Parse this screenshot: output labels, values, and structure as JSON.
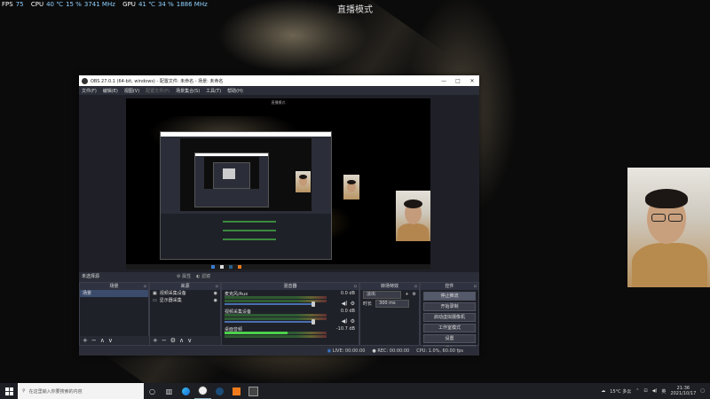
{
  "perf_overlay": [
    {
      "label": "FPS",
      "value": "75"
    },
    {
      "label": "CPU",
      "value": "40 ℃"
    },
    {
      "label": "",
      "value": "15 %"
    },
    {
      "label": "",
      "value": "3741 MHz"
    },
    {
      "label": "GPU",
      "value": "41 ℃"
    },
    {
      "label": "",
      "value": "34 %"
    },
    {
      "label": "",
      "value": "1886 MHz"
    }
  ],
  "live_banner": "直播模式",
  "obs": {
    "title": "OBS 27.0.1 (64-bit, windows) - 配置文件: 未命名 - 场景: 未命名",
    "window_controls": {
      "minimize": "—",
      "maximize": "□",
      "close": "✕"
    },
    "menu": [
      "文件(F)",
      "编辑(E)",
      "视图(V)",
      "配置文件(P)",
      "场景集合(S)",
      "工具(T)",
      "帮助(H)"
    ],
    "preview_label": "直播模式",
    "status_line": "未选择源",
    "scenes": {
      "header": "场景",
      "items": [
        "场景"
      ],
      "footer_icons": [
        "+",
        "−",
        "∧",
        "∨"
      ]
    },
    "sources": {
      "header": "来源",
      "items": [
        {
          "icon": "▣",
          "label": "视频采集设备"
        },
        {
          "icon": "▭",
          "label": "显示器采集"
        }
      ],
      "footer_icons": [
        "+",
        "−",
        "⚙",
        "∧",
        "∨"
      ],
      "props_label": "属性",
      "filters_label": "滤镜"
    },
    "mixer": {
      "header": "混音器",
      "channels": [
        {
          "name": "麦克风/Aux",
          "db": "0.0 dB",
          "level": 0.0
        },
        {
          "name": "视频采集设备",
          "db": "0.0 dB",
          "level": 0.0
        },
        {
          "name": "桌面音频",
          "db": "-10.7 dB",
          "level": 0.62
        }
      ]
    },
    "transitions": {
      "header": "转场特效",
      "type": "淡出",
      "duration_label": "时长",
      "duration": "300 ms"
    },
    "controls": {
      "header": "控件",
      "buttons": [
        "停止推流",
        "开始录制",
        "启动虚拟摄像机",
        "工作室模式",
        "设置",
        "退出"
      ]
    },
    "status": {
      "live_label": "LIVE:",
      "live_time": "00:00:00",
      "rec_label": "REC:",
      "rec_time": "00:00:00",
      "cpu": "CPU: 1.0%, 60.00 fps"
    }
  },
  "taskbar": {
    "search_placeholder": "在这里输入你要搜索的内容",
    "weather": "15°C 多云",
    "ime": "英",
    "time": "21:36",
    "date": "2021/10/17"
  }
}
